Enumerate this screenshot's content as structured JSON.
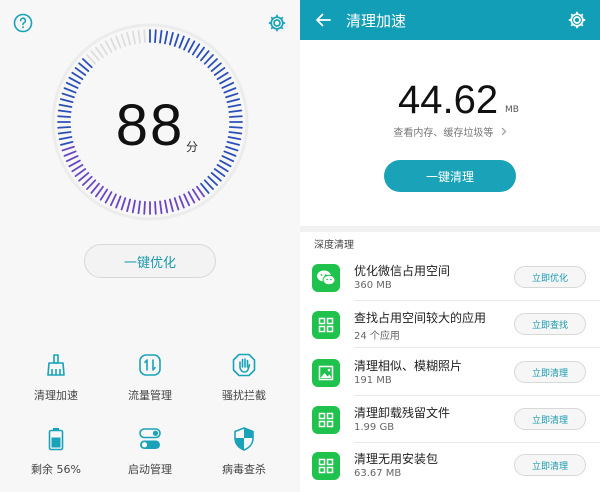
{
  "left": {
    "score": "88",
    "score_unit": "分",
    "optimize_label": "一键优化",
    "gauge_fraction": 0.88,
    "tools": [
      {
        "label": "清理加速",
        "icon": "broom-icon"
      },
      {
        "label": "流量管理",
        "icon": "data-usage-icon"
      },
      {
        "label": "骚扰拦截",
        "icon": "stop-hand-icon"
      },
      {
        "label": "剩余 56%",
        "icon": "battery-icon"
      },
      {
        "label": "启动管理",
        "icon": "toggle-icon"
      },
      {
        "label": "病毒查杀",
        "icon": "shield-icon"
      }
    ]
  },
  "right": {
    "title": "清理加速",
    "size_value": "44.62",
    "size_unit": "MB",
    "size_hint": "查看内存、缓存垃圾等",
    "clean_label": "一键清理",
    "section_label": "深度清理",
    "items": [
      {
        "title": "优化微信占用空间",
        "sub": "360 MB",
        "action": "立即优化",
        "icon": "wechat-icon"
      },
      {
        "title": "查找占用空间较大的应用",
        "sub": "24 个应用",
        "action": "立即查找",
        "icon": "apps-grid-icon"
      },
      {
        "title": "清理相似、模糊照片",
        "sub": "191 MB",
        "action": "立即清理",
        "icon": "photo-icon"
      },
      {
        "title": "清理卸载残留文件",
        "sub": "1.99 GB",
        "action": "立即清理",
        "icon": "apps-grid-icon"
      },
      {
        "title": "清理无用安装包",
        "sub": "63.67 MB",
        "action": "立即清理",
        "icon": "apps-grid-icon"
      }
    ]
  },
  "colors": {
    "accent": "#139eb7",
    "app_green": "#1fc24c",
    "gauge_blue": "#2a4fb8",
    "gauge_purple": "#6a46c2",
    "gauge_empty": "#dddddd"
  }
}
